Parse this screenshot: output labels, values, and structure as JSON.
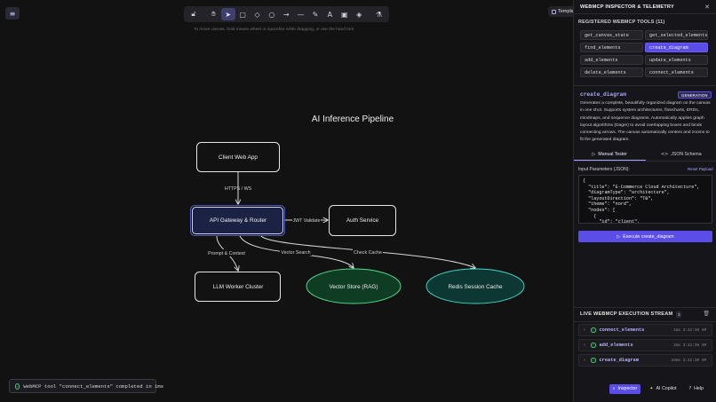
{
  "canvas": {
    "menu_icon": "hamburger-icon",
    "toolbar": [
      {
        "name": "lock-icon",
        "glyph": "🔓︎"
      },
      {
        "name": "hand-icon",
        "glyph": "✋︎"
      },
      {
        "name": "selection-icon",
        "glyph": "➤",
        "active": true
      },
      {
        "name": "rectangle-icon",
        "glyph": "▢"
      },
      {
        "name": "diamond-icon",
        "glyph": "◇"
      },
      {
        "name": "ellipse-icon",
        "glyph": "○"
      },
      {
        "name": "arrow-icon",
        "glyph": "→"
      },
      {
        "name": "line-icon",
        "glyph": "—"
      },
      {
        "name": "draw-icon",
        "glyph": "✎"
      },
      {
        "name": "text-icon",
        "glyph": "A"
      },
      {
        "name": "image-icon",
        "glyph": "▣"
      },
      {
        "name": "eraser-icon",
        "glyph": "◈"
      },
      {
        "name": "extra-tools-icon",
        "glyph": "⚗"
      }
    ],
    "hint": "To move canvas, hold mouse wheel or spacebar while dragging, or use the hand tool",
    "templates_label": "Templa",
    "diagram": {
      "title": "AI Inference Pipeline",
      "nodes": {
        "client": "Client Web App",
        "gateway": "API Gateway & Router",
        "auth": "Auth Service",
        "llm": "LLM Worker Cluster",
        "vector": "Vector Store (RAG)",
        "redis": "Redis Session Cache"
      },
      "edges": {
        "https": "HTTPS / WS",
        "jwt": "JWT Validate",
        "prompt": "Prompt & Context",
        "vsearch": "Vector Search",
        "cache": "Check Cache"
      }
    },
    "toast": "WebMCP tool \"connect_elements\" completed in 1ms"
  },
  "panel": {
    "title": "WEBMCP INSPECTOR & TELEMETRY",
    "close_icon": "close-icon",
    "tools_title": "REGISTERED WEBMCP TOOLS (11)",
    "tools": [
      "get_canvas_state",
      "get_selected_elements",
      "find_elements",
      "create_diagram",
      "add_elements",
      "update_elements",
      "delete_elements",
      "connect_elements"
    ],
    "selected_tool": "create_diagram",
    "badge": "GENERATION",
    "description": "Generates a complete, beautifully organized diagram on the canvas in one shot. Supports system architectures, flowcharts, ERDs, mindmaps, and sequence diagrams. Automatically applies graph layout algorithms (Dagre) to avoid overlapping boxes and binds connecting arrows. The canvas automatically centers and zooms to fit the generated diagram.",
    "tabs": {
      "manual": "Manual Tester",
      "schema": "JSON Schema"
    },
    "input_label": "Input Parameters (JSON):",
    "reset_label": "Reset Payload",
    "json_lines": [
      "{",
      "  \"title\": \"E-Commerce Cloud Architecture\",",
      "  \"diagramType\": \"architecture\",",
      "  \"layoutDirection\": \"TB\",",
      "  \"theme\": \"nord\",",
      "  \"nodes\": [",
      "    {",
      "      \"id\": \"client\","
    ],
    "execute_label": "Execute create_diagram",
    "stream_title": "LIVE WEBMCP EXECUTION STREAM",
    "stream_count": "3",
    "logs": [
      {
        "name": "connect_elements",
        "meta": "1ms  3:22:30 AM"
      },
      {
        "name": "add_elements",
        "meta": "2ms  3:22:30 AM"
      },
      {
        "name": "create_diagram",
        "meta": "19ms  3:22:30 AM"
      }
    ],
    "bottom": {
      "inspector": "Inspector",
      "copilot": "AI Copilot",
      "help": "Help"
    }
  },
  "colors": {
    "accent": "#5b4de8",
    "accent_light": "#a8a5ff",
    "success": "#3fcf6f",
    "vector_fill": "#0f3d24",
    "redis_fill": "#0c3733",
    "gateway_fill": "#1c2244"
  }
}
